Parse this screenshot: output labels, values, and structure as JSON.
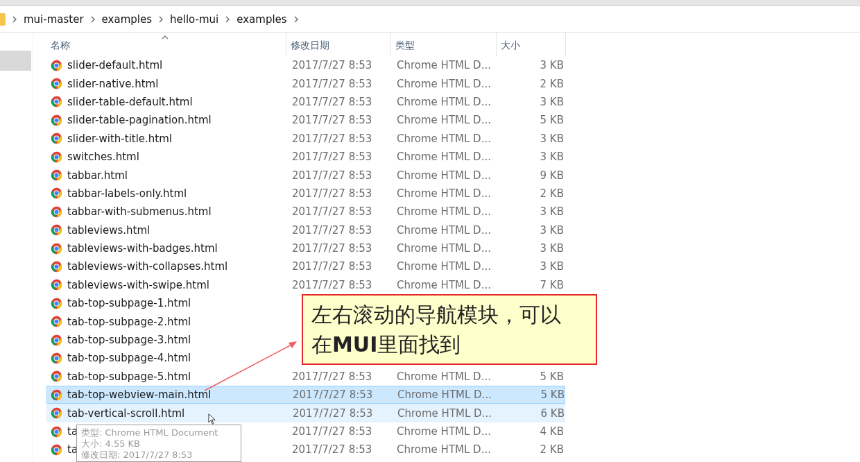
{
  "breadcrumb": [
    "mui-master",
    "examples",
    "hello-mui",
    "examples"
  ],
  "columns": [
    {
      "label": "名称",
      "sorted": true
    },
    {
      "label": "修改日期",
      "sorted": false
    },
    {
      "label": "类型",
      "sorted": false
    },
    {
      "label": "大小",
      "sorted": false
    }
  ],
  "rows": [
    {
      "name": "slider-default.html",
      "date": "2017/7/27 8:53",
      "type": "Chrome HTML D...",
      "size": "3 KB",
      "selected": false,
      "hot": false
    },
    {
      "name": "slider-native.html",
      "date": "2017/7/27 8:53",
      "type": "Chrome HTML D...",
      "size": "2 KB",
      "selected": false,
      "hot": false
    },
    {
      "name": "slider-table-default.html",
      "date": "2017/7/27 8:53",
      "type": "Chrome HTML D...",
      "size": "3 KB",
      "selected": false,
      "hot": false
    },
    {
      "name": "slider-table-pagination.html",
      "date": "2017/7/27 8:53",
      "type": "Chrome HTML D...",
      "size": "5 KB",
      "selected": false,
      "hot": false
    },
    {
      "name": "slider-with-title.html",
      "date": "2017/7/27 8:53",
      "type": "Chrome HTML D...",
      "size": "3 KB",
      "selected": false,
      "hot": false
    },
    {
      "name": "switches.html",
      "date": "2017/7/27 8:53",
      "type": "Chrome HTML D...",
      "size": "3 KB",
      "selected": false,
      "hot": false
    },
    {
      "name": "tabbar.html",
      "date": "2017/7/27 8:53",
      "type": "Chrome HTML D...",
      "size": "9 KB",
      "selected": false,
      "hot": false
    },
    {
      "name": "tabbar-labels-only.html",
      "date": "2017/7/27 8:53",
      "type": "Chrome HTML D...",
      "size": "2 KB",
      "selected": false,
      "hot": false
    },
    {
      "name": "tabbar-with-submenus.html",
      "date": "2017/7/27 8:53",
      "type": "Chrome HTML D...",
      "size": "3 KB",
      "selected": false,
      "hot": false
    },
    {
      "name": "tableviews.html",
      "date": "2017/7/27 8:53",
      "type": "Chrome HTML D...",
      "size": "3 KB",
      "selected": false,
      "hot": false
    },
    {
      "name": "tableviews-with-badges.html",
      "date": "2017/7/27 8:53",
      "type": "Chrome HTML D...",
      "size": "3 KB",
      "selected": false,
      "hot": false
    },
    {
      "name": "tableviews-with-collapses.html",
      "date": "2017/7/27 8:53",
      "type": "Chrome HTML D...",
      "size": "3 KB",
      "selected": false,
      "hot": false
    },
    {
      "name": "tableviews-with-swipe.html",
      "date": "2017/7/27 8:53",
      "type": "Chrome HTML D...",
      "size": "7 KB",
      "selected": false,
      "hot": false
    },
    {
      "name": "tab-top-subpage-1.html",
      "selected": false,
      "hot": false
    },
    {
      "name": "tab-top-subpage-2.html",
      "selected": false,
      "hot": false
    },
    {
      "name": "tab-top-subpage-3.html",
      "selected": false,
      "hot": false
    },
    {
      "name": "tab-top-subpage-4.html",
      "selected": false,
      "hot": false
    },
    {
      "name": "tab-top-subpage-5.html",
      "date": "2017/7/27 8:53",
      "type": "Chrome HTML D...",
      "size": "5 KB",
      "selected": false,
      "hot": false
    },
    {
      "name": "tab-top-webview-main.html",
      "date": "2017/7/27 8:53",
      "type": "Chrome HTML D...",
      "size": "5 KB",
      "selected": true,
      "hot": false
    },
    {
      "name": "tab-vertical-scroll.html",
      "date": "2017/7/27 8:53",
      "type": "Chrome HTML D...",
      "size": "6 KB",
      "selected": false,
      "hot": true
    },
    {
      "name": "ta",
      "date": "2017/7/27 8:53",
      "type": "Chrome HTML D...",
      "size": "4 KB",
      "selected": false,
      "hot": false
    },
    {
      "name": "ta",
      "date": "2017/7/27 8:53",
      "type": "Chrome HTML D...",
      "size": "2 KB",
      "selected": false,
      "hot": false
    }
  ],
  "tooltip": [
    "类型: Chrome HTML Document",
    "大小: 4.55 KB",
    "修改日期: 2017/7/27 8:53"
  ],
  "callout": "左右滚动的导航模块，可以在**MUI**里面找到"
}
